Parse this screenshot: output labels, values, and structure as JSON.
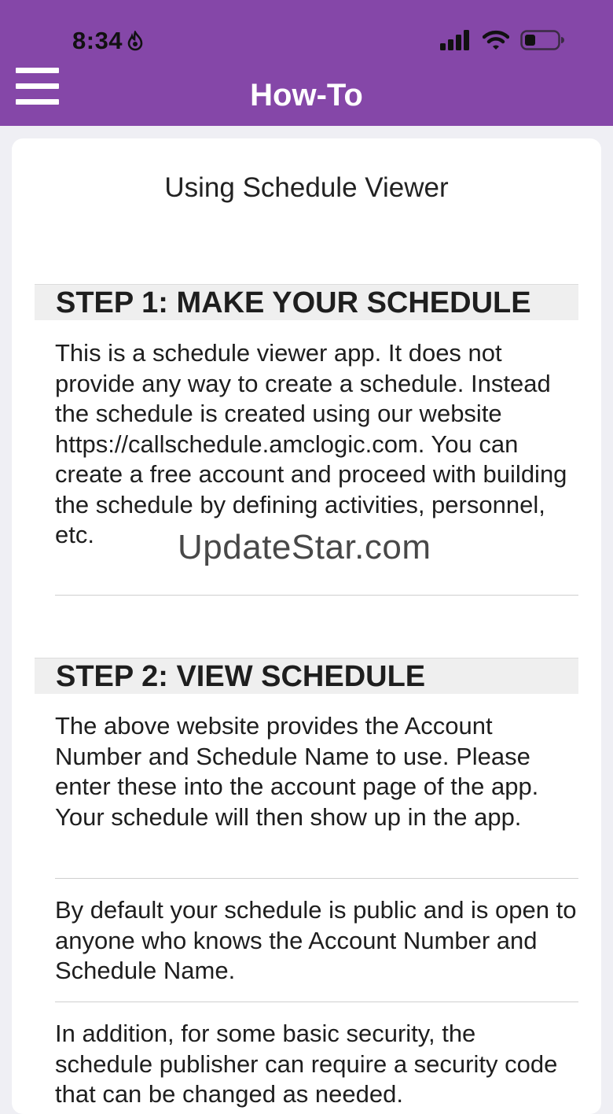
{
  "status_bar": {
    "time": "8:34"
  },
  "header": {
    "title": "How-To"
  },
  "content": {
    "title": "Using Schedule Viewer",
    "step1": {
      "heading": "STEP 1: MAKE YOUR SCHEDULE",
      "text": "This is a schedule viewer app. It does not provide any way to create a schedule. Instead the schedule is created using our website https://callschedule.amclogic.com. You can create a free account and proceed with building the schedule by defining activities, personnel, etc."
    },
    "step2": {
      "heading": "STEP 2: VIEW SCHEDULE",
      "paragraphs": [
        "The above website provides the Account Number and Schedule Name to use. Please enter these into the account page of the app. Your schedule will then show up in the app.",
        "By default your schedule is public and is open to anyone who knows the Account Number and Schedule Name.",
        "In addition, for some basic security, the schedule publisher can require a security code that can be changed as needed."
      ]
    }
  },
  "watermark": "UpdateStar.com",
  "colors": {
    "header_bg": "#8547a8",
    "page_bg": "#efeff4",
    "step_header_bg": "#efefef"
  }
}
